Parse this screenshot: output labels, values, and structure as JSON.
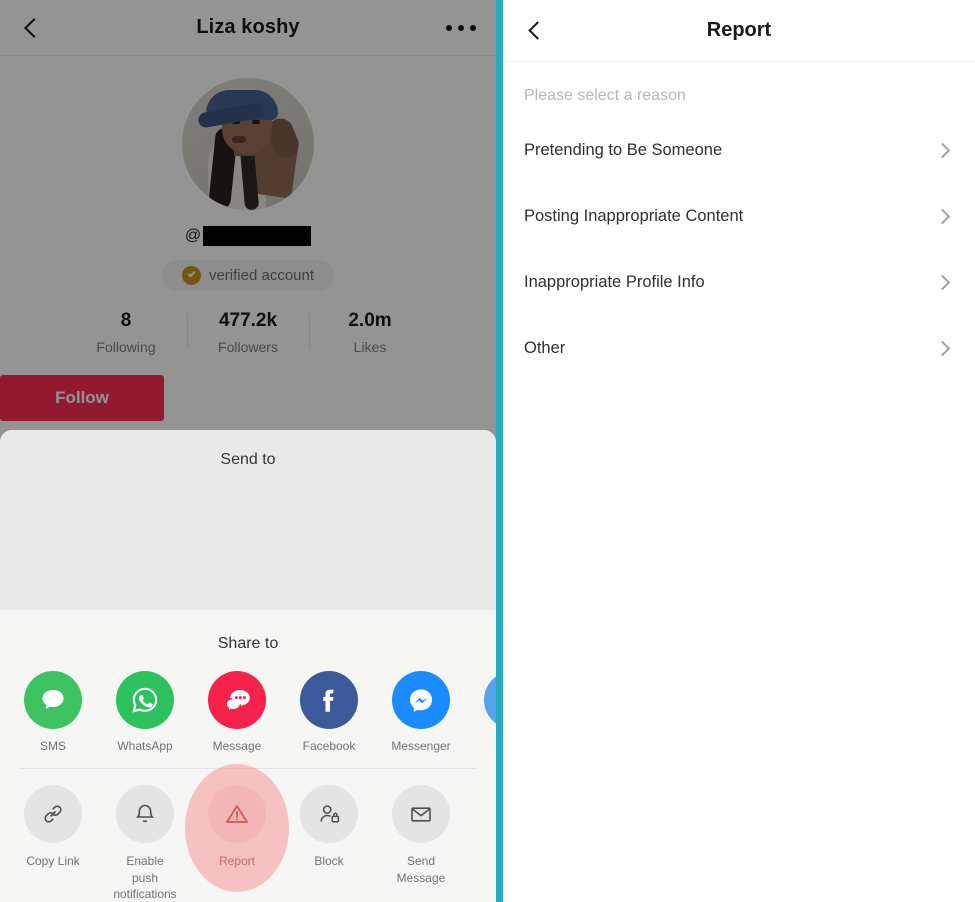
{
  "left": {
    "topbar": {
      "back_icon": "chevron-left-icon",
      "title": "Liza koshy",
      "more_icon": "ellipsis-icon"
    },
    "profile": {
      "avatar_icon": "user-avatar-photo",
      "handle_prefix": "@",
      "handle_redacted": "",
      "verified_label": "verified account",
      "verified_icon": "verified-check-icon",
      "verified_color": "#c9941f",
      "stats": [
        {
          "value": "8",
          "label": "Following"
        },
        {
          "value": "477.2k",
          "label": "Followers"
        },
        {
          "value": "2.0m",
          "label": "Likes"
        }
      ],
      "follow_label": "Follow",
      "follow_color": "#fe2c55"
    },
    "share_sheet": {
      "send_to_title": "Send to",
      "share_to_title": "Share to",
      "share_targets": [
        {
          "label": "SMS",
          "icon": "sms-bubble-icon",
          "color": "#3fc362"
        },
        {
          "label": "WhatsApp",
          "icon": "whatsapp-icon",
          "color": "#2ec25e"
        },
        {
          "label": "Message",
          "icon": "tiktok-message-icon",
          "color": "#f5224c"
        },
        {
          "label": "Facebook",
          "icon": "facebook-icon",
          "color": "#3c5a99"
        },
        {
          "label": "Messenger",
          "icon": "messenger-icon",
          "color": "#1b8cfe"
        },
        {
          "label": "",
          "icon": "more-share-icon",
          "color": "#55a4ec"
        }
      ],
      "actions": [
        {
          "label": "Copy Link",
          "icon": "link-icon",
          "highlighted": false
        },
        {
          "label": "Enable push notifications",
          "icon": "bell-icon",
          "highlighted": false
        },
        {
          "label": "Report",
          "icon": "warning-triangle-icon",
          "highlighted": true
        },
        {
          "label": "Block",
          "icon": "user-lock-icon",
          "highlighted": false
        },
        {
          "label": "Send Message",
          "icon": "envelope-icon",
          "highlighted": false
        }
      ]
    }
  },
  "divider_color": "#28abc0",
  "right": {
    "topbar": {
      "back_icon": "chevron-left-icon",
      "title": "Report"
    },
    "subtitle": "Please select a reason",
    "reasons": [
      {
        "label": "Pretending to Be Someone",
        "chevron": "chevron-right-icon"
      },
      {
        "label": "Posting Inappropriate Content",
        "chevron": "chevron-right-icon"
      },
      {
        "label": "Inappropriate Profile Info",
        "chevron": "chevron-right-icon"
      },
      {
        "label": "Other",
        "chevron": "chevron-right-icon"
      }
    ]
  }
}
